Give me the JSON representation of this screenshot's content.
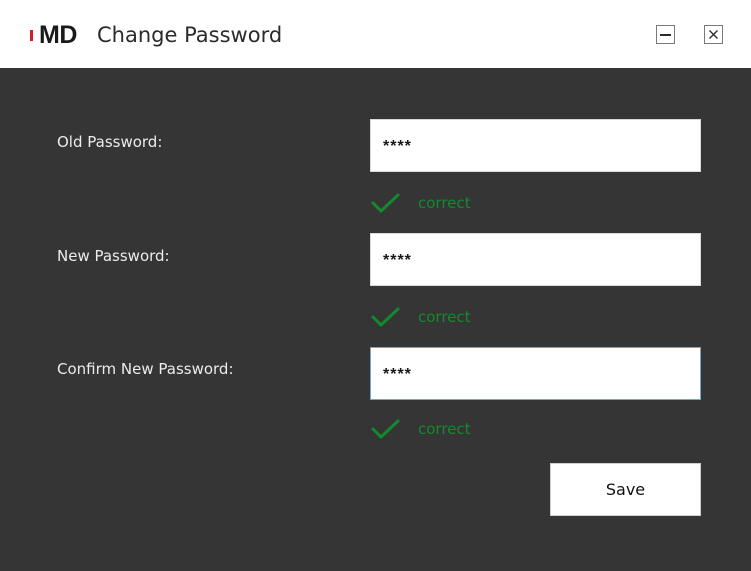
{
  "window": {
    "logo_text": "MD",
    "title": "Change Password",
    "minimize_icon": "minimize-icon",
    "close_icon": "close-icon"
  },
  "form": {
    "old_password": {
      "label": "Old Password:",
      "value": "****",
      "status_icon": "checkmark-icon",
      "status_text": "correct"
    },
    "new_password": {
      "label": "New Password:",
      "value": "****",
      "status_icon": "checkmark-icon",
      "status_text": "correct"
    },
    "confirm_password": {
      "label": "Confirm New Password:",
      "value": "****",
      "status_icon": "checkmark-icon",
      "status_text": "correct"
    },
    "save_label": "Save"
  },
  "colors": {
    "background": "#353535",
    "titlebar": "#ffffff",
    "logo_accent": "#d0202a",
    "success": "#138a2e",
    "label_text": "#ececec",
    "focus_border": "#6fa6d8"
  }
}
